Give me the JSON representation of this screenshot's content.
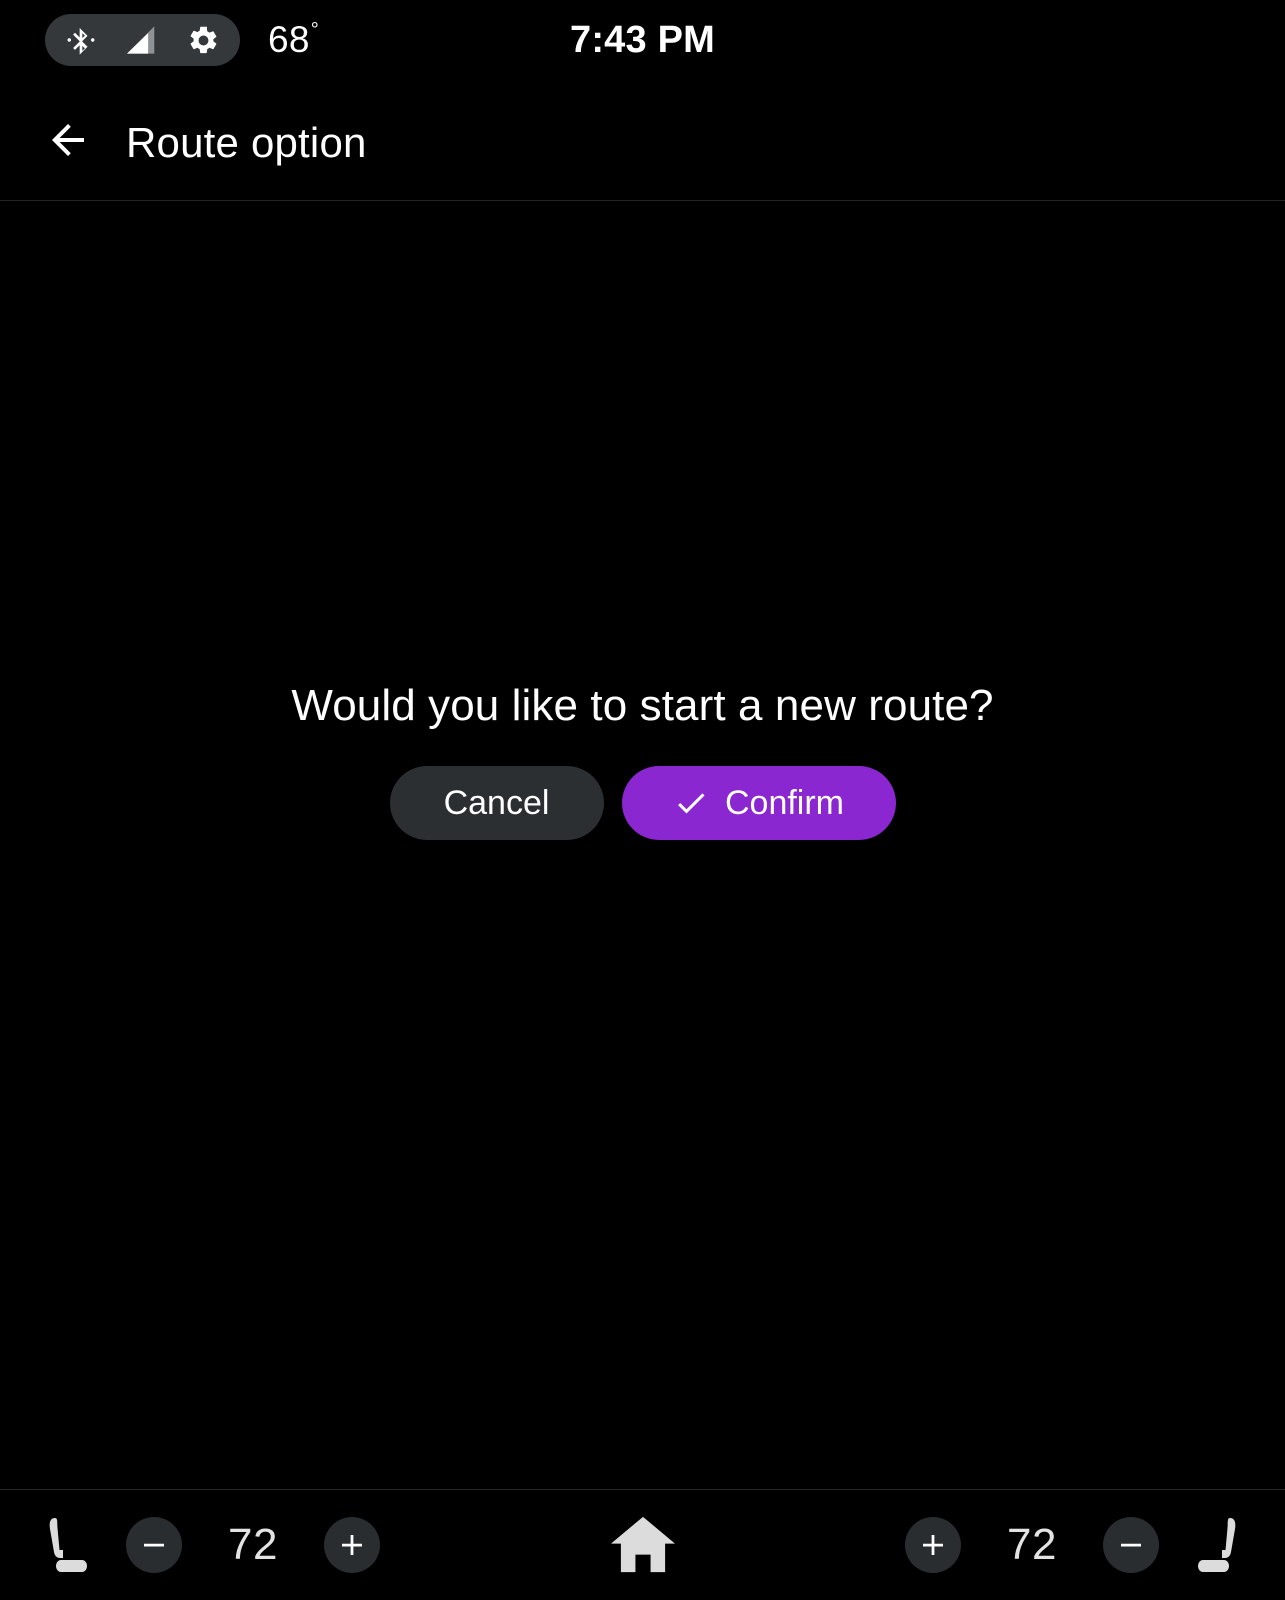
{
  "status_bar": {
    "pill_icons": [
      "bluetooth-icon",
      "signal-icon",
      "gear-icon"
    ],
    "temperature": "68",
    "degree_symbol": "°",
    "clock": "7:43 PM"
  },
  "header": {
    "back_icon": "back-arrow-icon",
    "title": "Route option"
  },
  "dialog": {
    "message": "Would you like to start a new route?",
    "cancel_label": "Cancel",
    "confirm_label": "Confirm",
    "confirm_icon": "check-icon",
    "confirm_color": "#8A27D0",
    "cancel_color": "#2C2F31"
  },
  "bottom_bar": {
    "left": {
      "seat_icon": "car-seat-icon",
      "decrease_label": "−",
      "temperature": "72",
      "increase_label": "+"
    },
    "home_icon": "home-icon",
    "right": {
      "increase_label": "+",
      "temperature": "72",
      "decrease_label": "−",
      "seat_icon": "car-seat-icon"
    }
  }
}
